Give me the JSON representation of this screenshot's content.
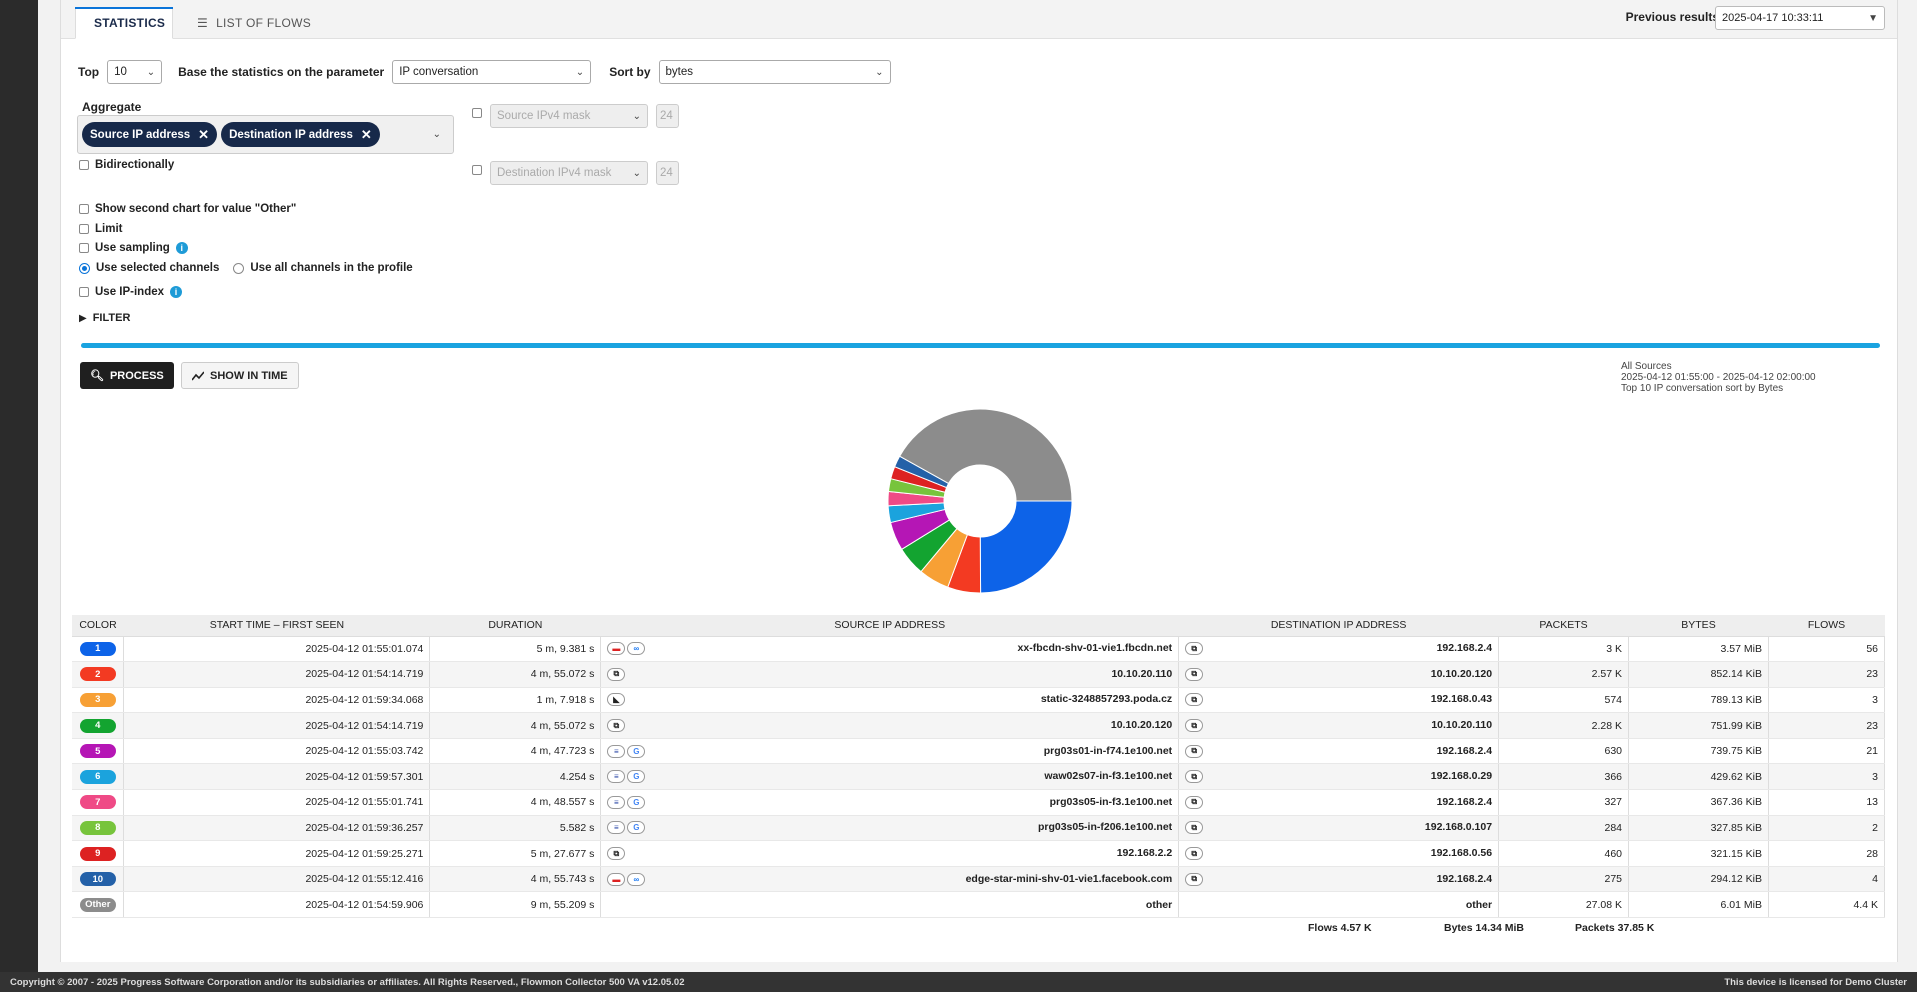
{
  "tabs": [
    {
      "label": "STATISTICS",
      "icon": "pie-icon"
    },
    {
      "label": "LIST OF FLOWS",
      "icon": "list-icon"
    }
  ],
  "previous_results": {
    "label": "Previous results",
    "value": "2025-04-17 10:33:11"
  },
  "controls": {
    "top_label": "Top",
    "top_value": "10",
    "base_label": "Base the statistics on the parameter",
    "base_value": "IP conversation",
    "sort_label": "Sort by",
    "sort_value": "bytes",
    "aggregate_label": "Aggregate",
    "aggregate_chips": [
      "Source IP address",
      "Destination IP address"
    ],
    "src_mask_placeholder": "Source IPv4 mask",
    "src_mask_value": "24",
    "dst_mask_placeholder": "Destination IPv4 mask",
    "dst_mask_value": "24",
    "bidirectional": "Bidirectionally",
    "show_second": "Show second chart for value \"Other\"",
    "limit": "Limit",
    "use_sampling": "Use sampling",
    "use_selected": "Use selected channels",
    "use_all": "Use all channels in the profile",
    "use_ip_index": "Use IP-index",
    "filter": "FILTER",
    "progress": 1.0
  },
  "buttons": {
    "process": "PROCESS",
    "show_in_time": "SHOW IN TIME"
  },
  "chart_info": {
    "line1": "All Sources",
    "line2": "2025-04-12 01:55:00 - 2025-04-12 02:00:00",
    "line3": "Top 10 IP conversation sort by Bytes"
  },
  "chart_data": {
    "type": "pie",
    "categories": [
      "1",
      "2",
      "3",
      "4",
      "5",
      "6",
      "7",
      "8",
      "9",
      "10",
      "Other"
    ],
    "values": [
      3.57,
      0.8324,
      0.7707,
      0.7343,
      0.7224,
      0.4196,
      0.3588,
      0.3202,
      0.3136,
      0.2872,
      6.01
    ],
    "colors": [
      "#0d63e8",
      "#f33a22",
      "#f7a035",
      "#13a430",
      "#b516b5",
      "#1ba3dd",
      "#ef4a86",
      "#77c43c",
      "#dd2222",
      "#2461a8",
      "#8c8c8c"
    ],
    "unit": "MiB"
  },
  "table": {
    "headers": [
      "COLOR",
      "START TIME – FIRST SEEN",
      "DURATION",
      "SOURCE IP ADDRESS",
      "DESTINATION IP ADDRESS",
      "PACKETS",
      "BYTES",
      "FLOWS"
    ],
    "rows": [
      {
        "badge": "1",
        "color": "#0d63e8",
        "start": "2025-04-12 01:55:01.074",
        "duration": "5 m, 9.381 s",
        "src_icons": [
          "flag-at-icon",
          "meta-icon"
        ],
        "src": "xx-fbcdn-shv-01-vie1.fbcdn.net",
        "dst_icons": [
          "local-network-icon"
        ],
        "dst": "192.168.2.4",
        "packets": "3 K",
        "bytes": "3.57 MiB",
        "flows": "56"
      },
      {
        "badge": "2",
        "color": "#f33a22",
        "start": "2025-04-12 01:54:14.719",
        "duration": "4 m, 55.072 s",
        "src_icons": [
          "local-network-icon"
        ],
        "src": "10.10.20.110",
        "dst_icons": [
          "local-network-icon"
        ],
        "dst": "10.10.20.120",
        "packets": "2.57 K",
        "bytes": "852.14 KiB",
        "flows": "23"
      },
      {
        "badge": "3",
        "color": "#f7a035",
        "start": "2025-04-12 01:59:34.068",
        "duration": "1 m, 7.918 s",
        "src_icons": [
          "flag-cz-icon"
        ],
        "src": "static-3248857293.poda.cz",
        "dst_icons": [
          "local-network-icon"
        ],
        "dst": "192.168.0.43",
        "packets": "574",
        "bytes": "789.13 KiB",
        "flows": "3"
      },
      {
        "badge": "4",
        "color": "#13a430",
        "start": "2025-04-12 01:54:14.719",
        "duration": "4 m, 55.072 s",
        "src_icons": [
          "local-network-icon"
        ],
        "src": "10.10.20.120",
        "dst_icons": [
          "local-network-icon"
        ],
        "dst": "10.10.20.110",
        "packets": "2.28 K",
        "bytes": "751.99 KiB",
        "flows": "23"
      },
      {
        "badge": "5",
        "color": "#b516b5",
        "start": "2025-04-12 01:55:03.742",
        "duration": "4 m, 47.723 s",
        "src_icons": [
          "flag-us-icon",
          "google-icon"
        ],
        "src": "prg03s01-in-f74.1e100.net",
        "dst_icons": [
          "local-network-icon"
        ],
        "dst": "192.168.2.4",
        "packets": "630",
        "bytes": "739.75 KiB",
        "flows": "21"
      },
      {
        "badge": "6",
        "color": "#1ba3dd",
        "start": "2025-04-12 01:59:57.301",
        "duration": "4.254 s",
        "src_icons": [
          "flag-us-icon",
          "google-icon"
        ],
        "src": "waw02s07-in-f3.1e100.net",
        "dst_icons": [
          "local-network-icon"
        ],
        "dst": "192.168.0.29",
        "packets": "366",
        "bytes": "429.62 KiB",
        "flows": "3"
      },
      {
        "badge": "7",
        "color": "#ef4a86",
        "start": "2025-04-12 01:55:01.741",
        "duration": "4 m, 48.557 s",
        "src_icons": [
          "flag-us-icon",
          "google-icon"
        ],
        "src": "prg03s05-in-f3.1e100.net",
        "dst_icons": [
          "local-network-icon"
        ],
        "dst": "192.168.2.4",
        "packets": "327",
        "bytes": "367.36 KiB",
        "flows": "13"
      },
      {
        "badge": "8",
        "color": "#77c43c",
        "start": "2025-04-12 01:59:36.257",
        "duration": "5.582 s",
        "src_icons": [
          "flag-us-icon",
          "google-icon"
        ],
        "src": "prg03s05-in-f206.1e100.net",
        "dst_icons": [
          "local-network-icon"
        ],
        "dst": "192.168.0.107",
        "packets": "284",
        "bytes": "327.85 KiB",
        "flows": "2"
      },
      {
        "badge": "9",
        "color": "#dd2222",
        "start": "2025-04-12 01:59:25.271",
        "duration": "5 m, 27.677 s",
        "src_icons": [
          "local-network-icon"
        ],
        "src": "192.168.2.2",
        "dst_icons": [
          "local-network-icon"
        ],
        "dst": "192.168.0.56",
        "packets": "460",
        "bytes": "321.15 KiB",
        "flows": "28"
      },
      {
        "badge": "10",
        "color": "#2461a8",
        "start": "2025-04-12 01:55:12.416",
        "duration": "4 m, 55.743 s",
        "src_icons": [
          "flag-at-icon",
          "meta-icon"
        ],
        "src": "edge-star-mini-shv-01-vie1.facebook.com",
        "dst_icons": [
          "local-network-icon"
        ],
        "dst": "192.168.2.4",
        "packets": "275",
        "bytes": "294.12 KiB",
        "flows": "4"
      },
      {
        "badge": "Other",
        "color": "#8c8c8c",
        "start": "2025-04-12 01:54:59.906",
        "duration": "9 m, 55.209 s",
        "src_icons": [],
        "src": "other",
        "dst_icons": [],
        "dst": "other",
        "packets": "27.08 K",
        "bytes": "6.01 MiB",
        "flows": "4.4 K"
      }
    ],
    "totals": {
      "flows": "Flows 4.57 K",
      "bytes": "Bytes 14.34 MiB",
      "packets": "Packets 37.85 K"
    }
  },
  "footer": {
    "left": "Copyright © 2007 - 2025 Progress Software Corporation and/or its subsidiaries or affiliates. All Rights Reserved., Flowmon Collector 500 VA v12.05.02",
    "right": "This device is licensed for Demo Cluster"
  }
}
